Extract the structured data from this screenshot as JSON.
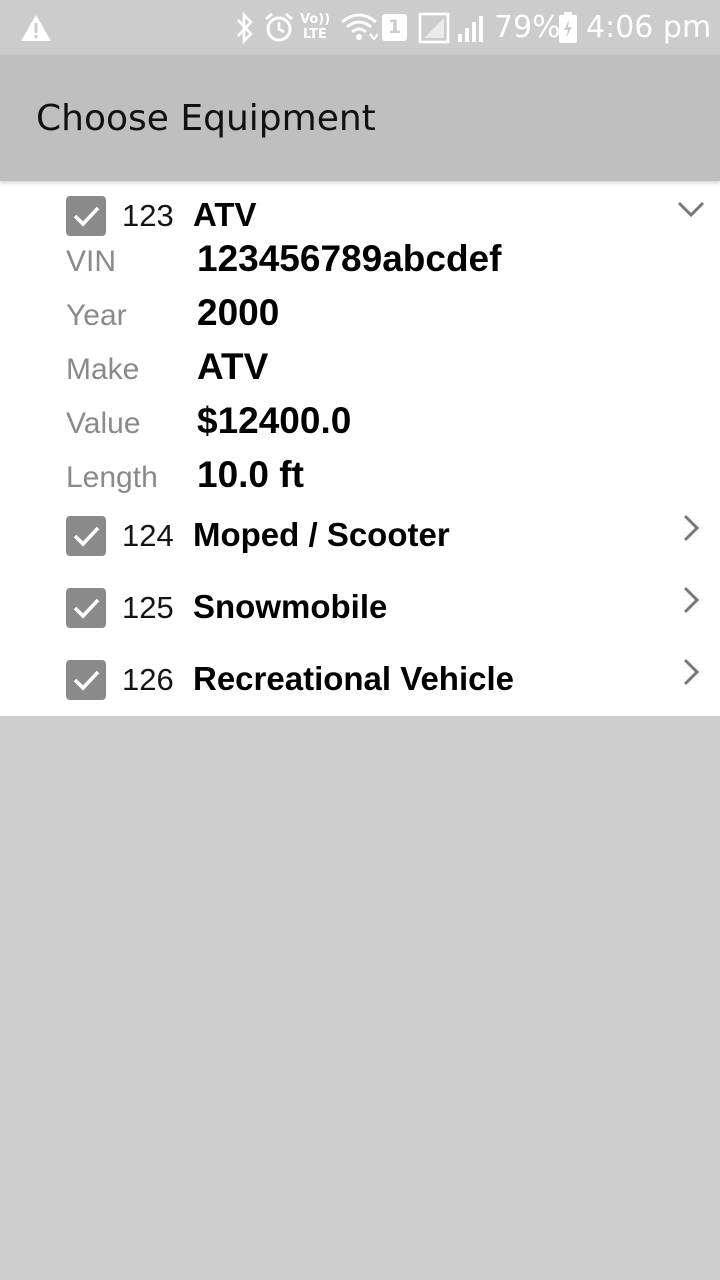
{
  "status_bar": {
    "battery": "79%",
    "time": "4:06 pm",
    "sim_slot": "1",
    "volte": "Vo)) LTE",
    "icons": [
      "warning-icon",
      "bluetooth-icon",
      "alarm-icon",
      "volte-icon",
      "wifi-icon",
      "sim-icon",
      "signal-icon",
      "battery-icon"
    ]
  },
  "app_bar": {
    "title": "Choose Equipment"
  },
  "equipment": [
    {
      "number": "123",
      "name": "ATV",
      "checked": true,
      "expanded": true,
      "details": [
        {
          "label": "VIN",
          "value": "123456789abcdef"
        },
        {
          "label": "Year",
          "value": "2000"
        },
        {
          "label": "Make",
          "value": "ATV"
        },
        {
          "label": "Value",
          "value": "$12400.0"
        },
        {
          "label": "Length",
          "value": "10.0 ft"
        }
      ]
    },
    {
      "number": "124",
      "name": "Moped / Scooter",
      "checked": true,
      "expanded": false
    },
    {
      "number": "125",
      "name": "Snowmobile",
      "checked": true,
      "expanded": false
    },
    {
      "number": "126",
      "name": "Recreational Vehicle",
      "checked": true,
      "expanded": false
    }
  ],
  "colors": {
    "checkbox": "#8a8a8a",
    "app_bar": "#bfbfbf",
    "background": "#cdcdcd"
  }
}
